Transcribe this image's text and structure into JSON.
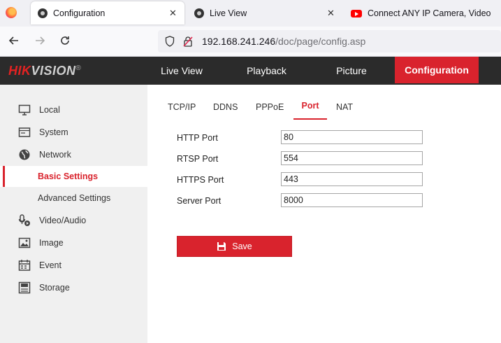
{
  "browser": {
    "tabs": [
      {
        "title": "Configuration",
        "active": true
      },
      {
        "title": "Live View",
        "active": false
      },
      {
        "title": "Connect ANY IP Camera, Video",
        "active": false
      }
    ],
    "url_host": "192.168.241.246",
    "url_path": "/doc/page/config.asp"
  },
  "header": {
    "brand_main": "HIK",
    "brand_accent": "VISION",
    "brand_mark": "®",
    "menu": [
      "Live View",
      "Playback",
      "Picture",
      "Configuration"
    ],
    "active_menu": "Configuration",
    "accent_color": "#d9232d"
  },
  "sidebar": {
    "items": [
      {
        "label": "Local",
        "icon": "monitor-icon"
      },
      {
        "label": "System",
        "icon": "system-icon"
      },
      {
        "label": "Network",
        "icon": "globe-icon"
      },
      {
        "label": "Basic Settings",
        "sub": true,
        "selected": true
      },
      {
        "label": "Advanced Settings",
        "sub": true
      },
      {
        "label": "Video/Audio",
        "icon": "microphone-icon"
      },
      {
        "label": "Image",
        "icon": "image-icon"
      },
      {
        "label": "Event",
        "icon": "calendar-icon"
      },
      {
        "label": "Storage",
        "icon": "storage-icon"
      }
    ]
  },
  "content": {
    "tabs": [
      "TCP/IP",
      "DDNS",
      "PPPoE",
      "Port",
      "NAT"
    ],
    "active_tab": "Port",
    "fields": [
      {
        "label": "HTTP Port",
        "value": "80"
      },
      {
        "label": "RTSP Port",
        "value": "554"
      },
      {
        "label": "HTTPS Port",
        "value": "443"
      },
      {
        "label": "Server Port",
        "value": "8000"
      }
    ],
    "save_label": "Save"
  }
}
